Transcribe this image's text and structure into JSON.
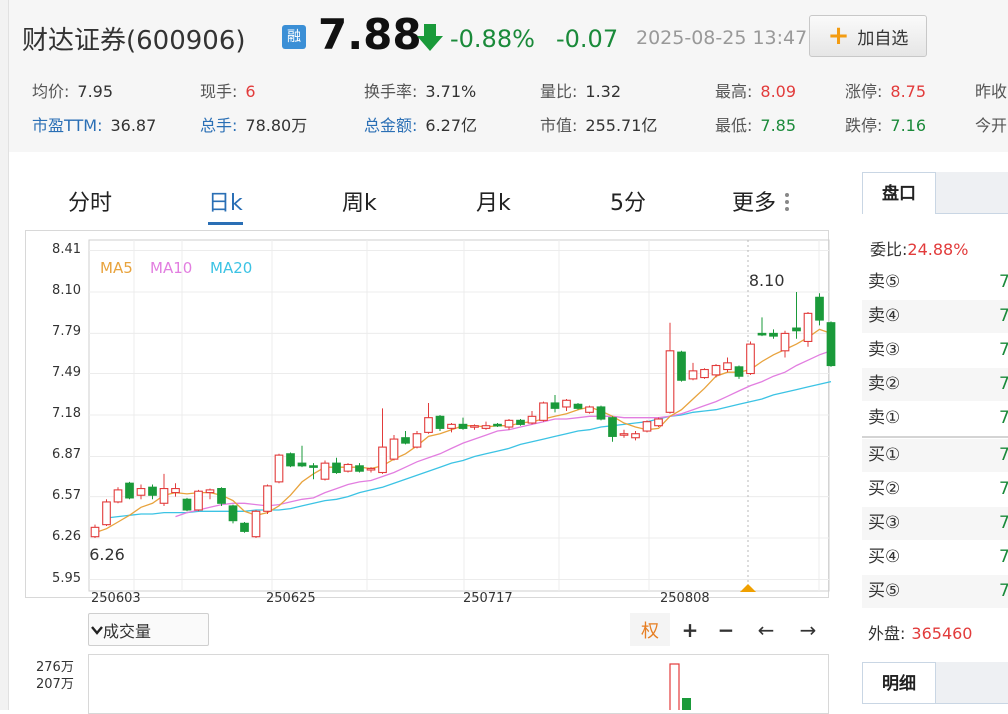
{
  "header": {
    "stock_name": "财达证券(600906)",
    "margin_badge": "融",
    "price": "7.88",
    "change_pct": "-0.88%",
    "change_abs": "-0.07",
    "timestamp": "2025-08-25 13:47",
    "add_watch_label": "加自选",
    "down_color": "#1a8a3a",
    "up_color": "#e23b3b"
  },
  "stats": {
    "row1": [
      {
        "label": "均价:",
        "value": "7.95",
        "tone": "plain"
      },
      {
        "label": "现手:",
        "value": "6",
        "tone": "red"
      },
      {
        "label": "换手率:",
        "value": "3.71%",
        "tone": "plain"
      },
      {
        "label": "量比:",
        "value": "1.32",
        "tone": "plain"
      },
      {
        "label": "最高:",
        "value": "8.09",
        "tone": "red"
      },
      {
        "label": "涨停:",
        "value": "8.75",
        "tone": "red"
      },
      {
        "label": "昨收",
        "value": "",
        "tone": "plain"
      }
    ],
    "row2": [
      {
        "label": "市盈TTM:",
        "value": "36.87",
        "tone": "plain"
      },
      {
        "label": "总手:",
        "value": "78.80万",
        "tone": "plain"
      },
      {
        "label": "总金额:",
        "value": "6.27亿",
        "tone": "plain"
      },
      {
        "label": "市值:",
        "value": "255.71亿",
        "tone": "plain"
      },
      {
        "label": "最低:",
        "value": "7.85",
        "tone": "green"
      },
      {
        "label": "跌停:",
        "value": "7.16",
        "tone": "green"
      },
      {
        "label": "今开",
        "value": "",
        "tone": "plain"
      }
    ]
  },
  "chart_tabs": [
    "分时",
    "日k",
    "周k",
    "月k",
    "5分",
    "更多"
  ],
  "active_tab": "日k",
  "ma_legend": [
    {
      "name": "MA5",
      "color": "#e8a33d"
    },
    {
      "name": "MA10",
      "color": "#e27ee0"
    },
    {
      "name": "MA20",
      "color": "#3cc3e4"
    }
  ],
  "chart_data": {
    "type": "candlestick",
    "y_ticks": [
      "8.41",
      "8.10",
      "7.79",
      "7.49",
      "7.18",
      "6.87",
      "6.57",
      "6.26",
      "5.95"
    ],
    "ylim": [
      5.95,
      8.41
    ],
    "x_ticks": [
      "250603",
      "250625",
      "250717",
      "250808"
    ],
    "max_label": "8.10",
    "min_label": "6.26",
    "candles": [
      {
        "o": 6.27,
        "c": 6.34,
        "h": 6.36,
        "l": 6.26
      },
      {
        "o": 6.36,
        "c": 6.53,
        "h": 6.55,
        "l": 6.35
      },
      {
        "o": 6.53,
        "c": 6.62,
        "h": 6.64,
        "l": 6.52
      },
      {
        "o": 6.67,
        "c": 6.56,
        "h": 6.68,
        "l": 6.55
      },
      {
        "o": 6.58,
        "c": 6.63,
        "h": 6.66,
        "l": 6.55
      },
      {
        "o": 6.64,
        "c": 6.58,
        "h": 6.66,
        "l": 6.55
      },
      {
        "o": 6.52,
        "c": 6.63,
        "h": 6.74,
        "l": 6.5
      },
      {
        "o": 6.6,
        "c": 6.63,
        "h": 6.67,
        "l": 6.57
      },
      {
        "o": 6.55,
        "c": 6.47,
        "h": 6.56,
        "l": 6.46
      },
      {
        "o": 6.47,
        "c": 6.61,
        "h": 6.62,
        "l": 6.46
      },
      {
        "o": 6.6,
        "c": 6.62,
        "h": 6.63,
        "l": 6.55
      },
      {
        "o": 6.63,
        "c": 6.52,
        "h": 6.64,
        "l": 6.5
      },
      {
        "o": 6.5,
        "c": 6.39,
        "h": 6.51,
        "l": 6.37
      },
      {
        "o": 6.37,
        "c": 6.31,
        "h": 6.38,
        "l": 6.3
      },
      {
        "o": 6.27,
        "c": 6.46,
        "h": 6.47,
        "l": 6.26
      },
      {
        "o": 6.46,
        "c": 6.65,
        "h": 6.66,
        "l": 6.44
      },
      {
        "o": 6.68,
        "c": 6.88,
        "h": 6.89,
        "l": 6.67
      },
      {
        "o": 6.89,
        "c": 6.8,
        "h": 6.9,
        "l": 6.79
      },
      {
        "o": 6.82,
        "c": 6.8,
        "h": 6.95,
        "l": 6.79
      },
      {
        "o": 6.8,
        "c": 6.79,
        "h": 6.82,
        "l": 6.7
      },
      {
        "o": 6.7,
        "c": 6.82,
        "h": 6.84,
        "l": 6.69
      },
      {
        "o": 6.82,
        "c": 6.75,
        "h": 6.86,
        "l": 6.74
      },
      {
        "o": 6.76,
        "c": 6.81,
        "h": 6.82,
        "l": 6.75
      },
      {
        "o": 6.8,
        "c": 6.76,
        "h": 6.82,
        "l": 6.75
      },
      {
        "o": 6.77,
        "c": 6.78,
        "h": 6.79,
        "l": 6.75
      },
      {
        "o": 6.75,
        "c": 6.94,
        "h": 7.23,
        "l": 6.74
      },
      {
        "o": 6.85,
        "c": 7.0,
        "h": 7.03,
        "l": 6.84
      },
      {
        "o": 7.01,
        "c": 6.97,
        "h": 7.06,
        "l": 6.96
      },
      {
        "o": 6.94,
        "c": 7.04,
        "h": 7.06,
        "l": 6.93
      },
      {
        "o": 7.05,
        "c": 7.16,
        "h": 7.27,
        "l": 7.04
      },
      {
        "o": 7.17,
        "c": 7.08,
        "h": 7.18,
        "l": 7.06
      },
      {
        "o": 7.08,
        "c": 7.11,
        "h": 7.12,
        "l": 7.05
      },
      {
        "o": 7.11,
        "c": 7.08,
        "h": 7.16,
        "l": 7.07
      },
      {
        "o": 7.09,
        "c": 7.1,
        "h": 7.11,
        "l": 7.07
      },
      {
        "o": 7.08,
        "c": 7.1,
        "h": 7.13,
        "l": 7.07
      },
      {
        "o": 7.11,
        "c": 7.1,
        "h": 7.12,
        "l": 7.09
      },
      {
        "o": 7.09,
        "c": 7.14,
        "h": 7.15,
        "l": 7.07
      },
      {
        "o": 7.14,
        "c": 7.11,
        "h": 7.15,
        "l": 7.1
      },
      {
        "o": 7.12,
        "c": 7.17,
        "h": 7.21,
        "l": 7.11
      },
      {
        "o": 7.14,
        "c": 7.27,
        "h": 7.28,
        "l": 7.13
      },
      {
        "o": 7.27,
        "c": 7.23,
        "h": 7.33,
        "l": 7.2
      },
      {
        "o": 7.24,
        "c": 7.29,
        "h": 7.3,
        "l": 7.21
      },
      {
        "o": 7.26,
        "c": 7.23,
        "h": 7.27,
        "l": 7.22
      },
      {
        "o": 7.2,
        "c": 7.24,
        "h": 7.25,
        "l": 7.19
      },
      {
        "o": 7.24,
        "c": 7.15,
        "h": 7.25,
        "l": 7.14
      },
      {
        "o": 7.16,
        "c": 7.02,
        "h": 7.17,
        "l": 6.98
      },
      {
        "o": 7.04,
        "c": 7.04,
        "h": 7.07,
        "l": 7.01
      },
      {
        "o": 7.01,
        "c": 7.04,
        "h": 7.06,
        "l": 6.99
      },
      {
        "o": 7.06,
        "c": 7.13,
        "h": 7.14,
        "l": 7.05
      },
      {
        "o": 7.1,
        "c": 7.15,
        "h": 7.16,
        "l": 7.09
      },
      {
        "o": 7.2,
        "c": 7.66,
        "h": 7.87,
        "l": 7.19
      },
      {
        "o": 7.65,
        "c": 7.44,
        "h": 7.66,
        "l": 7.43
      },
      {
        "o": 7.45,
        "c": 7.51,
        "h": 7.57,
        "l": 7.44
      },
      {
        "o": 7.46,
        "c": 7.52,
        "h": 7.53,
        "l": 7.45
      },
      {
        "o": 7.48,
        "c": 7.55,
        "h": 7.56,
        "l": 7.46
      },
      {
        "o": 7.52,
        "c": 7.57,
        "h": 7.61,
        "l": 7.5
      },
      {
        "o": 7.54,
        "c": 7.47,
        "h": 7.55,
        "l": 7.45
      },
      {
        "o": 7.49,
        "c": 7.71,
        "h": 7.73,
        "l": 7.48
      },
      {
        "o": 7.79,
        "c": 7.78,
        "h": 7.91,
        "l": 7.77
      },
      {
        "o": 7.79,
        "c": 7.77,
        "h": 7.82,
        "l": 7.75
      },
      {
        "o": 7.66,
        "c": 7.79,
        "h": 7.81,
        "l": 7.61
      },
      {
        "o": 7.83,
        "c": 7.81,
        "h": 8.1,
        "l": 7.75
      },
      {
        "o": 7.73,
        "c": 7.94,
        "h": 7.95,
        "l": 7.69
      },
      {
        "o": 8.06,
        "c": 7.89,
        "h": 8.09,
        "l": 7.85
      },
      {
        "o": 7.87,
        "c": 7.55,
        "h": 7.88,
        "l": 7.54
      }
    ],
    "ma5": [
      6.3,
      6.33,
      6.38,
      6.43,
      6.49,
      6.52,
      6.58,
      6.6,
      6.59,
      6.6,
      6.6,
      6.58,
      6.54,
      6.46,
      6.43,
      6.45,
      6.5,
      6.58,
      6.68,
      6.74,
      6.79,
      6.79,
      6.79,
      6.79,
      6.78,
      6.8,
      6.85,
      6.89,
      6.95,
      7.02,
      7.04,
      7.07,
      7.1,
      7.1,
      7.09,
      7.1,
      7.1,
      7.12,
      7.13,
      7.15,
      7.17,
      7.19,
      7.22,
      7.24,
      7.21,
      7.17,
      7.12,
      7.09,
      7.07,
      7.08,
      7.17,
      7.22,
      7.3,
      7.38,
      7.47,
      7.5,
      7.5,
      7.52,
      7.58,
      7.63,
      7.67,
      7.71,
      7.76,
      7.82,
      7.79
    ],
    "ma10": [
      null,
      null,
      null,
      null,
      null,
      null,
      null,
      6.42,
      6.45,
      6.47,
      6.49,
      6.51,
      6.52,
      6.52,
      6.51,
      6.5,
      6.51,
      6.53,
      6.55,
      6.56,
      6.6,
      6.63,
      6.66,
      6.68,
      6.69,
      6.72,
      6.75,
      6.79,
      6.83,
      6.86,
      6.89,
      6.93,
      6.97,
      7.0,
      7.03,
      7.06,
      7.07,
      7.09,
      7.11,
      7.13,
      7.15,
      7.15,
      7.16,
      7.17,
      7.17,
      7.17,
      7.16,
      7.16,
      7.16,
      7.16,
      7.17,
      7.19,
      7.22,
      7.25,
      7.28,
      7.32,
      7.36,
      7.4,
      7.43,
      7.47,
      7.5,
      7.55,
      7.59,
      7.63,
      7.66
    ],
    "ma20": [
      null,
      6.41,
      6.42,
      6.43,
      6.44,
      6.44,
      6.45,
      6.45,
      6.45,
      6.46,
      6.46,
      6.46,
      6.46,
      6.46,
      6.47,
      6.47,
      6.47,
      6.48,
      6.5,
      6.52,
      6.54,
      6.55,
      6.57,
      6.6,
      6.62,
      6.64,
      6.67,
      6.7,
      6.73,
      6.76,
      6.79,
      6.82,
      6.84,
      6.87,
      6.89,
      6.91,
      6.93,
      6.96,
      6.98,
      7.0,
      7.02,
      7.04,
      7.06,
      7.07,
      7.09,
      7.1,
      7.11,
      7.12,
      7.13,
      7.15,
      7.17,
      7.18,
      7.2,
      7.21,
      7.22,
      7.24,
      7.26,
      7.28,
      7.3,
      7.33,
      7.35,
      7.37,
      7.39,
      7.41,
      7.43
    ]
  },
  "chart_toolbar": {
    "indicator_select": "成交量",
    "quan_label": "权",
    "zoom_in": "+",
    "zoom_out": "−",
    "pan_left": "←",
    "pan_right": "→"
  },
  "volume": {
    "y_ticks": [
      "276万",
      "207万"
    ]
  },
  "order_panel": {
    "tab_label": "盘口",
    "weibi_label": "委比:",
    "weibi_value": "24.88%",
    "rows": [
      {
        "label": "卖⑤",
        "price": "7"
      },
      {
        "label": "卖④",
        "price": "7"
      },
      {
        "label": "卖③",
        "price": "7"
      },
      {
        "label": "卖②",
        "price": "7"
      },
      {
        "label": "卖①",
        "price": "7"
      },
      {
        "label": "买①",
        "price": "7"
      },
      {
        "label": "买②",
        "price": "7"
      },
      {
        "label": "买③",
        "price": "7"
      },
      {
        "label": "买④",
        "price": "7"
      },
      {
        "label": "买⑤",
        "price": "7"
      }
    ],
    "outer_label": "外盘:",
    "outer_value": "365460",
    "detail_tab_label": "明细"
  }
}
